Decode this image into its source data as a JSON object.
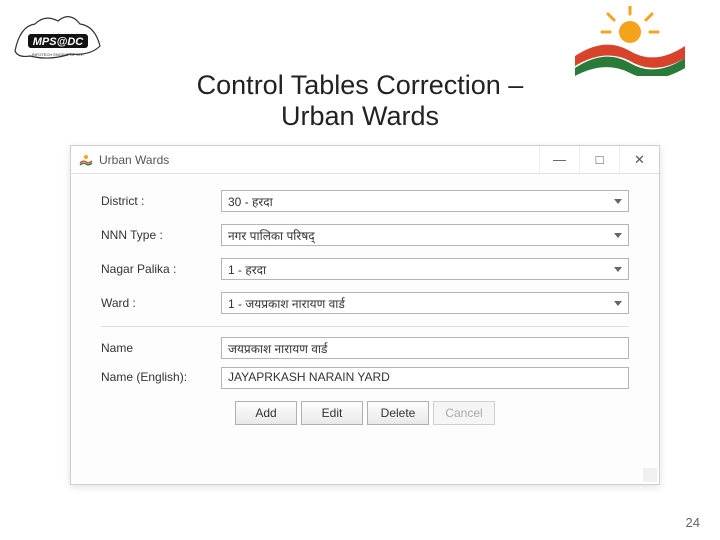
{
  "page_title_line1": "Control Tables Correction –",
  "page_title_line2": "Urban Wards",
  "window": {
    "title": "Urban Wards",
    "controls": {
      "min": "—",
      "max": "□",
      "close": "✕"
    }
  },
  "form": {
    "district_label": "District :",
    "district_value": "30 - हरदा",
    "nnn_type_label": "NNN Type :",
    "nnn_type_value": "नगर पालिका परिषद्",
    "nagar_palika_label": "Nagar Palika :",
    "nagar_palika_value": "1 - हरदा",
    "ward_label": "Ward :",
    "ward_value": "1 - जयप्रकाश नारायण वार्ड",
    "name_label": "Name",
    "name_value": "जयप्रकाश नारायण वार्ड",
    "name_en_label": "Name (English):",
    "name_en_value": "JAYAPRKASH NARAIN YARD"
  },
  "buttons": {
    "add": "Add",
    "edit": "Edit",
    "delete": "Delete",
    "cancel": "Cancel"
  },
  "page_number": "24"
}
